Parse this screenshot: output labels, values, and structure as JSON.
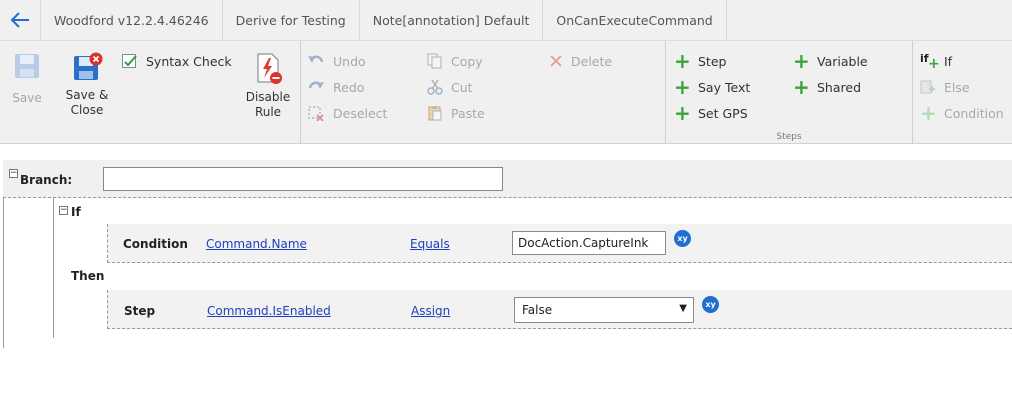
{
  "tabs": [
    {
      "label": "Woodford v12.2.4.46246"
    },
    {
      "label": "Derive for Testing"
    },
    {
      "label": "Note[annotation] Default"
    },
    {
      "label": "OnCanExecuteCommand"
    }
  ],
  "ribbon": {
    "save": "Save",
    "save_close_1": "Save &",
    "save_close_2": "Close",
    "syntax_check": "Syntax Check",
    "disable_rule_1": "Disable",
    "disable_rule_2": "Rule",
    "undo": "Undo",
    "redo": "Redo",
    "deselect": "Deselect",
    "copy": "Copy",
    "cut": "Cut",
    "paste": "Paste",
    "delete": "Delete",
    "steps": {
      "step": "Step",
      "say_text": "Say Text",
      "set_gps": "Set GPS",
      "variable": "Variable",
      "shared": "Shared",
      "group_label": "Steps"
    },
    "if_group": {
      "if_icon_text": "if",
      "if": "If",
      "else": "Else",
      "condition": "Condition"
    }
  },
  "editor": {
    "branch_label": "Branch:",
    "branch_value": "",
    "if_label": "If",
    "then_label": "Then",
    "condition": {
      "label": "Condition",
      "field": "Command.Name",
      "operator": "Equals",
      "value": "DocAction.CaptureInk",
      "xy": "xy"
    },
    "step": {
      "label": "Step",
      "field": "Command.IsEnabled",
      "operator": "Assign",
      "value": "False",
      "xy": "xy"
    }
  },
  "colors": {
    "accent_blue": "#1f6fd0",
    "link": "#1f3fbf",
    "plus_green": "#3aa33a"
  }
}
